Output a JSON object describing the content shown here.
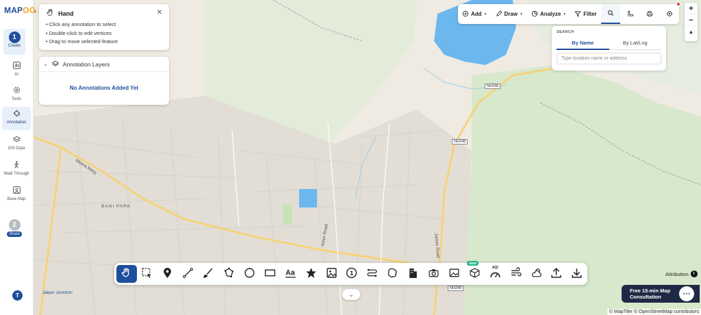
{
  "app": {
    "logo_main": "MAP",
    "logo_accent": "OG"
  },
  "sidebar": {
    "step1_number": "1",
    "step1_label": "Create",
    "items": [
      {
        "label": "AI",
        "icon": "ai-icon"
      },
      {
        "label": "Tools",
        "icon": "gear-icon"
      },
      {
        "label": "Annotation",
        "icon": "paint-bucket-icon"
      },
      {
        "label": "GIS Data",
        "icon": "layers-icon"
      },
      {
        "label": "Walk Through",
        "icon": "walk-icon"
      },
      {
        "label": "Base Map",
        "icon": "base-map-icon"
      }
    ],
    "step2_number": "2",
    "step2_label": "Share",
    "avatar": "T"
  },
  "hand_panel": {
    "title": "Hand",
    "close": "✕",
    "tips": [
      "• Click any annotation to select",
      "• Double-click to edit vertices",
      "• Drag to move selected feature"
    ]
  },
  "layers_panel": {
    "title": "Annotation Layers",
    "empty_text": "No Annotations Added Yet"
  },
  "toolbar": {
    "add": "Add",
    "draw": "Draw",
    "analyze": "Analyze",
    "filter": "Filter"
  },
  "zoom": {
    "in": "+",
    "out": "−",
    "north": "▲"
  },
  "search": {
    "title": "SEARCH",
    "tab_name": "By Name",
    "tab_latlng": "By Lat/Lng",
    "placeholder": "Type location name or address"
  },
  "bottom_tools": [
    "hand-tool",
    "select-tool",
    "marker-tool",
    "line-tool",
    "freehand-tool",
    "polygon-tool",
    "circle-tool",
    "rectangle-tool",
    "text-tool",
    "star-tool",
    "image-tool",
    "numbered-marker-tool",
    "route-tool",
    "freeform-shape-tool",
    "building-tool",
    "camera-tool",
    "photo-tool",
    "3d-cube-tool",
    "aqi-tool",
    "wind-tool",
    "weather-tool",
    "upload-tool",
    "download-tool"
  ],
  "bottom_badges": {
    "new": "NEW",
    "aqi": "AQI",
    "number": "1"
  },
  "map": {
    "labels": {
      "bani_park": "BANI PARK",
      "meera_marg": "Meera Marg",
      "ajmer_road": "Amer Road",
      "james_road": "James Road",
      "jaipur_junction": "Jaipur Junction"
    },
    "shields": [
      "NH248",
      "NH248",
      "NH248"
    ]
  },
  "consultation": {
    "line1": "Free 15-min Map",
    "line2": "Consultation",
    "chat": "⋯"
  },
  "attribution": {
    "label": "Attribution",
    "info": "i"
  },
  "credits": "© MapTiler © OpenStreetMap contributors",
  "colors": {
    "brand": "#1f4f9c",
    "accent": "#f4a21c",
    "water": "#6cb7ee",
    "park": "#d9ead0"
  }
}
